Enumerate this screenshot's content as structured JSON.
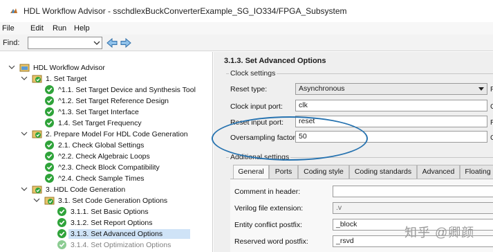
{
  "window": {
    "title": "HDL Workflow Advisor - sschdlexBuckConverterExample_SG_IO334/FPGA_Subsystem",
    "app_icon": "matlab-icon"
  },
  "menu": {
    "items": [
      "File",
      "Edit",
      "Run",
      "Help"
    ]
  },
  "findbar": {
    "label": "Find:",
    "value": "",
    "back_icon": "arrow-left-icon",
    "forward_icon": "arrow-right-icon"
  },
  "tree": {
    "items": [
      {
        "label": "HDL Workflow Advisor",
        "icon": "folder-icon",
        "expanded": true
      },
      {
        "label": "1. Set Target",
        "icon": "folder-check-icon",
        "expanded": true
      },
      {
        "label": "^1.1. Set Target Device and Synthesis Tool",
        "icon": "passed-icon"
      },
      {
        "label": "^1.2. Set Target Reference Design",
        "icon": "passed-icon"
      },
      {
        "label": "^1.3. Set Target Interface",
        "icon": "passed-icon"
      },
      {
        "label": "1.4. Set Target Frequency",
        "icon": "passed-icon"
      },
      {
        "label": "2. Prepare Model For HDL Code Generation",
        "icon": "folder-check-icon",
        "expanded": true
      },
      {
        "label": "2.1. Check Global Settings",
        "icon": "passed-icon"
      },
      {
        "label": "^2.2. Check Algebraic Loops",
        "icon": "passed-icon"
      },
      {
        "label": "^2.3. Check Block Compatibility",
        "icon": "passed-icon"
      },
      {
        "label": "^2.4. Check Sample Times",
        "icon": "passed-icon"
      },
      {
        "label": "3. HDL Code Generation",
        "icon": "folder-check-icon",
        "expanded": true
      },
      {
        "label": "3.1. Set Code Generation Options",
        "icon": "folder-check-icon",
        "expanded": true
      },
      {
        "label": "3.1.1. Set Basic Options",
        "icon": "passed-icon"
      },
      {
        "label": "3.1.2. Set Report Options",
        "icon": "passed-icon"
      },
      {
        "label": "3.1.3. Set Advanced Options",
        "icon": "passed-icon",
        "selected": true
      },
      {
        "label": "3.1.4. Set Optimization Options",
        "icon": "passed-icon"
      }
    ]
  },
  "panel": {
    "title": "3.1.3. Set Advanced Options",
    "clock_group": {
      "label": "Clock settings",
      "reset_type": {
        "label": "Reset type:",
        "value": "Asynchronous"
      },
      "clock_input_port": {
        "label": "Clock input port:",
        "value": "clk"
      },
      "reset_input_port": {
        "label": "Reset input port:",
        "value": "reset"
      },
      "oversampling": {
        "label": "Oversampling factor:",
        "value": "50"
      },
      "cut_chars": [
        "F",
        "C",
        "R",
        "C"
      ]
    },
    "additional_group": {
      "label": "Additional settings",
      "tabs": [
        "General",
        "Ports",
        "Coding style",
        "Coding standards",
        "Advanced",
        "Floating"
      ],
      "active_tab": "General",
      "fields": {
        "comment": {
          "label": "Comment in header:",
          "value": ""
        },
        "verilog_ext": {
          "label": "Verilog file extension:",
          "value": ".v"
        },
        "entity_postfix": {
          "label": "Entity conflict postfix:",
          "value": "_block"
        },
        "reserved_postfix": {
          "label": "Reserved word postfix:",
          "value": "_rsvd"
        }
      }
    }
  },
  "watermark": "知乎 @卿颜",
  "colors": {
    "selection": "#cfe3f7",
    "annotation_ellipse": "#2773b0",
    "pass_green": "#2fa33a"
  }
}
